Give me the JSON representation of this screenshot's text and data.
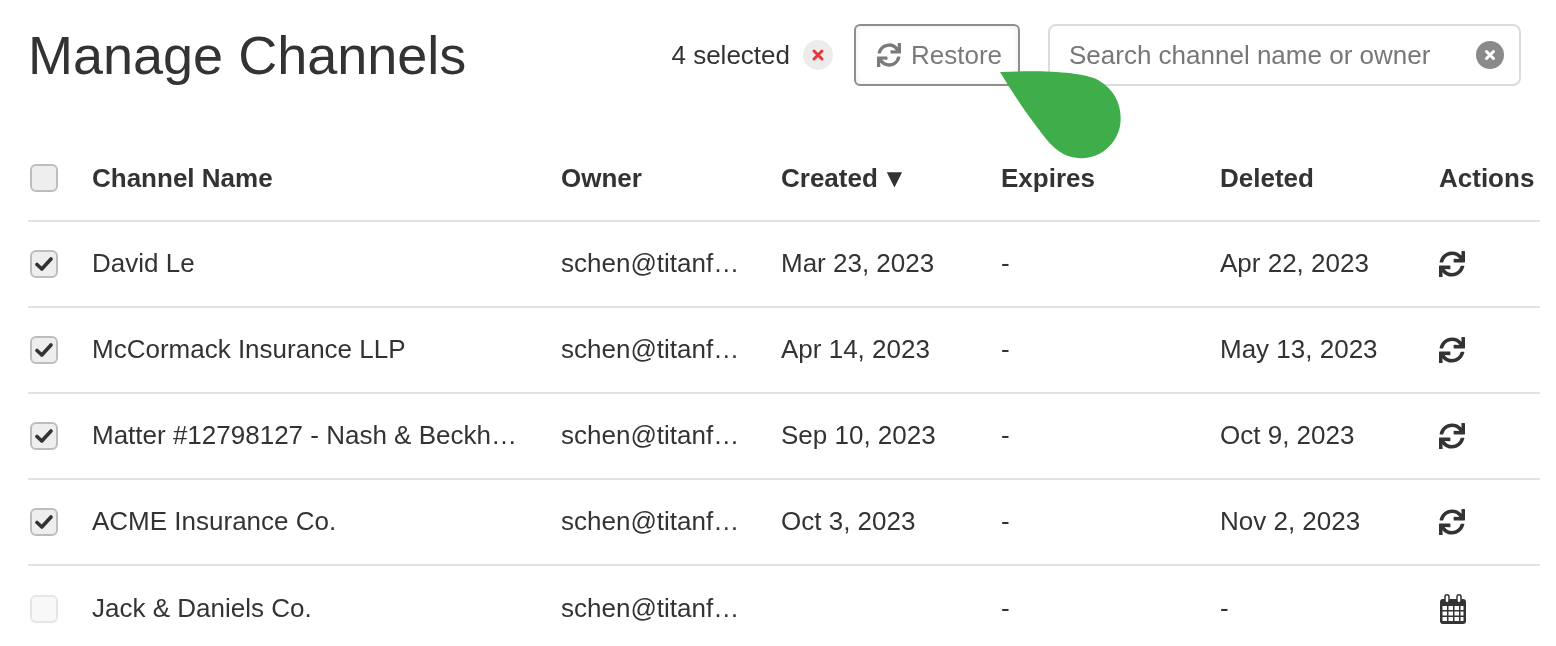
{
  "page": {
    "title": "Manage Channels"
  },
  "toolbar": {
    "selection_count": "4 selected",
    "restore_button": {
      "label": "Restore"
    },
    "search": {
      "placeholder": "Search channel name or owner"
    }
  },
  "table": {
    "select_all": {
      "checked": false
    },
    "columns": [
      {
        "label": "Channel Name"
      },
      {
        "label": "Owner"
      },
      {
        "label": "Created",
        "sort_indicator": "▼"
      },
      {
        "label": "Expires"
      },
      {
        "label": "Deleted"
      },
      {
        "label": "Actions"
      }
    ],
    "rows": [
      {
        "checked": true,
        "disabled": false,
        "name": "David Le",
        "owner": "schen@titanf…",
        "created": "Mar 23, 2023",
        "expires": "-",
        "deleted": "Apr 22, 2023",
        "action": {
          "kind": "restore"
        }
      },
      {
        "checked": true,
        "disabled": false,
        "name": "McCormack Insurance LLP",
        "owner": "schen@titanf…",
        "created": "Apr 14, 2023",
        "expires": "-",
        "deleted": "May 13, 2023",
        "action": {
          "kind": "restore"
        }
      },
      {
        "checked": true,
        "disabled": false,
        "name": "Matter #12798127 - Nash & Beckh…",
        "owner": "schen@titanf…",
        "created": "Sep 10, 2023",
        "expires": "-",
        "deleted": "Oct 9, 2023",
        "action": {
          "kind": "restore"
        }
      },
      {
        "checked": true,
        "disabled": false,
        "name": "ACME Insurance Co.",
        "owner": "schen@titanf…",
        "created": "Oct 3, 2023",
        "expires": "-",
        "deleted": "Nov 2, 2023",
        "action": {
          "kind": "restore"
        }
      },
      {
        "checked": false,
        "disabled": true,
        "name": "Jack & Daniels Co.",
        "owner": "schen@titanf…",
        "expires": "-",
        "deleted": "-",
        "action": {
          "kind": "schedule"
        }
      }
    ]
  }
}
